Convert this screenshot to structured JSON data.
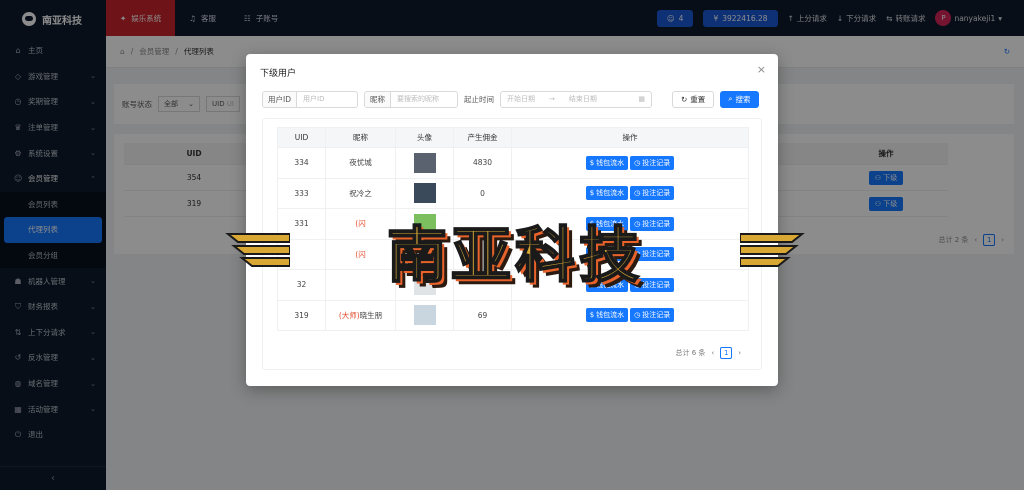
{
  "app": {
    "logo_text": "南亚科技"
  },
  "sidebar": {
    "items": [
      {
        "label": "主页",
        "icon": "home-icon",
        "glyph": "⌂"
      },
      {
        "label": "游戏管理",
        "icon": "gamepad-icon",
        "glyph": "◇",
        "chevron": "⌄"
      },
      {
        "label": "奖期管理",
        "icon": "clock-icon",
        "glyph": "◷",
        "chevron": "⌄"
      },
      {
        "label": "注单管理",
        "icon": "trophy-icon",
        "glyph": "♛",
        "chevron": "⌄"
      },
      {
        "label": "系统设置",
        "icon": "gear-icon",
        "glyph": "⚙",
        "chevron": "⌄"
      },
      {
        "label": "会员管理",
        "icon": "user-icon",
        "glyph": "☺",
        "chevron": "⌃"
      }
    ],
    "sub_items": [
      {
        "label": "会员列表"
      },
      {
        "label": "代理列表",
        "active": true
      },
      {
        "label": "会员分组"
      }
    ],
    "items_after": [
      {
        "label": "机器人管理",
        "icon": "robot-icon",
        "glyph": "☗",
        "chevron": "⌄"
      },
      {
        "label": "财务报表",
        "icon": "shield-icon",
        "glyph": "⛉",
        "chevron": "⌄"
      },
      {
        "label": "上下分请求",
        "icon": "transfer-icon",
        "glyph": "⇅",
        "chevron": "⌄"
      },
      {
        "label": "反水管理",
        "icon": "refund-icon",
        "glyph": "↺",
        "chevron": "⌄"
      },
      {
        "label": "域名管理",
        "icon": "globe-icon",
        "glyph": "◍",
        "chevron": "⌄"
      },
      {
        "label": "活动管理",
        "icon": "calendar-icon",
        "glyph": "▦",
        "chevron": "⌄"
      },
      {
        "label": "退出",
        "icon": "logout-icon",
        "glyph": "⏻"
      }
    ],
    "collapse_glyph": "‹"
  },
  "topbar": {
    "nav": [
      {
        "label": "娱乐系统",
        "icon": "gift-icon",
        "glyph": "✦",
        "active": true
      },
      {
        "label": "客服",
        "icon": "headset-icon",
        "glyph": "♫"
      },
      {
        "label": "子账号",
        "icon": "users-icon",
        "glyph": "☷"
      }
    ],
    "online_count": "4",
    "balance": "3922416.28",
    "link_up": "上分请求",
    "link_down": "下分请求",
    "link_transfer": "转账请求",
    "username": "nanyakeji1",
    "avatar_letter": "P",
    "glyph_user": "☺",
    "glyph_money": "¥",
    "glyph_up": "↑",
    "glyph_down": "↓",
    "glyph_transfer": "⇆",
    "glyph_caret": "▾"
  },
  "breadcrumb": {
    "home_glyph": "⌂",
    "sep": "/",
    "level1": "会员管理",
    "level2": "代理列表",
    "refresh_glyph": "↻"
  },
  "filter": {
    "status_label": "账号状态",
    "status_value": "全部",
    "uid_label": "UID",
    "uid_trunc": "UI",
    "select_caret": "⌄"
  },
  "bg_table": {
    "headers": {
      "uid": "UID",
      "op": "操作"
    },
    "rows": [
      {
        "uid": "354",
        "btn": "下级"
      },
      {
        "uid": "319",
        "btn": "下级"
      }
    ],
    "total": "总计 2 条",
    "page": "1",
    "prev": "‹",
    "next": "›",
    "btn_glyph": "⚇"
  },
  "modal": {
    "title": "下级用户",
    "close": "×",
    "uid_label": "用户ID",
    "uid_placeholder": "用户ID",
    "nick_label": "昵称",
    "nick_placeholder": "要搜索的昵称",
    "time_label": "起止时间",
    "start_placeholder": "开始日期",
    "range_sep": "→",
    "end_placeholder": "结束日期",
    "calendar_glyph": "▦",
    "reset_label": "重置",
    "reset_glyph": "↻",
    "search_label": "搜索",
    "search_glyph": "⌕",
    "columns": [
      "UID",
      "昵称",
      "头像",
      "产生佣金",
      "操作"
    ],
    "rows": [
      {
        "uid": "334",
        "nick_prefix": "",
        "nick": "夜忧城",
        "commission": "4830",
        "av_color": "#5a6270"
      },
      {
        "uid": "333",
        "nick_prefix": "",
        "nick": "祝冷之",
        "commission": "0",
        "av_color": "#3a4a5a"
      },
      {
        "uid": "331",
        "nick_prefix": "(闪",
        "nick": "",
        "commission": "",
        "av_color": "#7cbf5e"
      },
      {
        "uid": "",
        "nick_prefix": "(闪",
        "nick": "",
        "commission": "",
        "av_color": "#c8ccd0"
      },
      {
        "uid": "32",
        "nick_prefix": "",
        "nick": "",
        "commission": "",
        "av_color": "#dfe3e6"
      },
      {
        "uid": "319",
        "nick_prefix": "(大师)",
        "nick": "晓生朋",
        "commission": "69",
        "av_color": "#c9d6e0"
      }
    ],
    "btn_wallet": "钱包流水",
    "btn_bet": "投注记录",
    "wallet_glyph": "$",
    "bet_glyph": "◷",
    "total": "总计 6 条",
    "page": "1",
    "prev": "‹",
    "next": "›"
  },
  "watermark": {
    "text": "南亚科技"
  }
}
